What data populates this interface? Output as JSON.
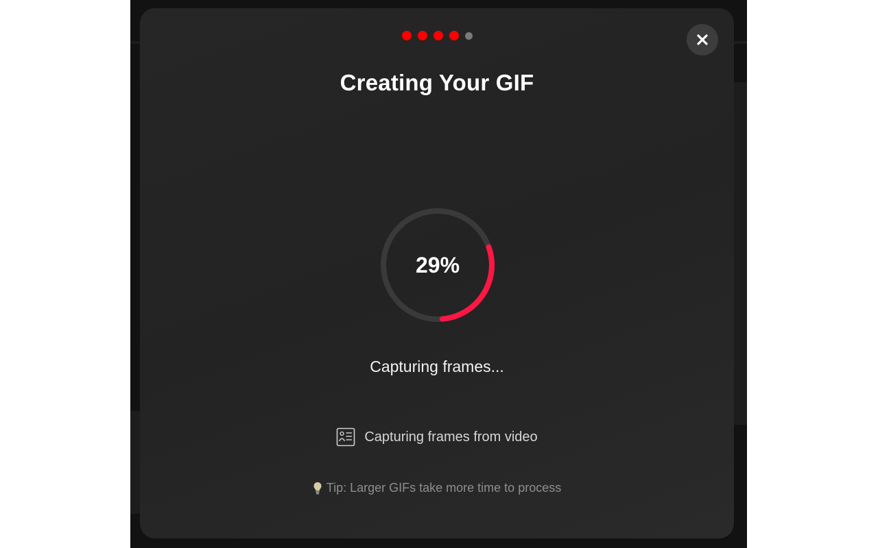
{
  "modal": {
    "title": "Creating Your GIF",
    "close_icon": "close-icon",
    "steps": {
      "total": 5,
      "completed": 4,
      "active_color": "#ff0000",
      "inactive_color": "#7a7a7a"
    }
  },
  "progress": {
    "label": "29%",
    "fraction": 0.29,
    "ring_color": "#ff1744",
    "track_color": "#3a3a3a"
  },
  "status": {
    "text": "Capturing frames...",
    "step_icon": "frames-icon",
    "step_text": "Capturing frames from video"
  },
  "tip": {
    "icon": "lightbulb-icon",
    "text": "Tip: Larger GIFs take more time to process"
  }
}
